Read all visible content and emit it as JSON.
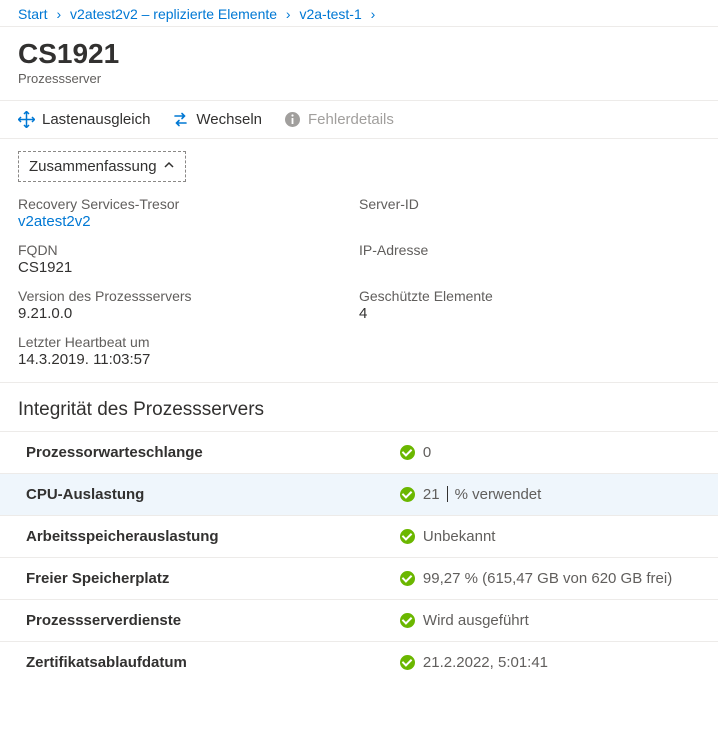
{
  "breadcrumb": {
    "items": [
      {
        "label": "Start"
      },
      {
        "label": "v2atest2v2 – replizierte Elemente"
      },
      {
        "label": "v2a-test-1"
      }
    ]
  },
  "header": {
    "title": "CS1921",
    "subtitle": "Prozessserver"
  },
  "toolbar": {
    "load_balance": "Lastenausgleich",
    "switch": "Wechseln",
    "error_details": "Fehlerdetails"
  },
  "summary_toggle": "Zusammenfassung",
  "summary": {
    "left": [
      {
        "label": "Recovery Services-Tresor",
        "value": "v2atest2v2",
        "link": true
      },
      {
        "label": "FQDN",
        "value": "CS1921"
      },
      {
        "label": "Version des Prozessservers",
        "value": "9.21.0.0"
      },
      {
        "label": "Letzter Heartbeat um",
        "value": "14.3.2019. 11:03:57"
      }
    ],
    "right": [
      {
        "label": "Server-ID",
        "value": ""
      },
      {
        "label": "IP-Adresse",
        "value": ""
      },
      {
        "label": "Geschützte Elemente",
        "value": "4"
      }
    ]
  },
  "health_title": "Integrität des Prozessservers",
  "health": [
    {
      "label": "Prozessorwarteschlange",
      "value": "0",
      "highlight": false
    },
    {
      "label": "CPU-Auslastung",
      "value_pre": "21",
      "value_post": " % verwendet",
      "highlight": true,
      "cursor": true
    },
    {
      "label": "Arbeitsspeicherauslastung",
      "value": "Unbekannt",
      "highlight": false
    },
    {
      "label": "Freier Speicherplatz",
      "value": "99,27 % (615,47 GB von 620 GB frei)",
      "highlight": false
    },
    {
      "label": "Prozessserverdienste",
      "value": "Wird ausgeführt",
      "highlight": false
    },
    {
      "label": "Zertifikatsablaufdatum",
      "value": "21.2.2022, 5:01:41",
      "highlight": false
    }
  ]
}
